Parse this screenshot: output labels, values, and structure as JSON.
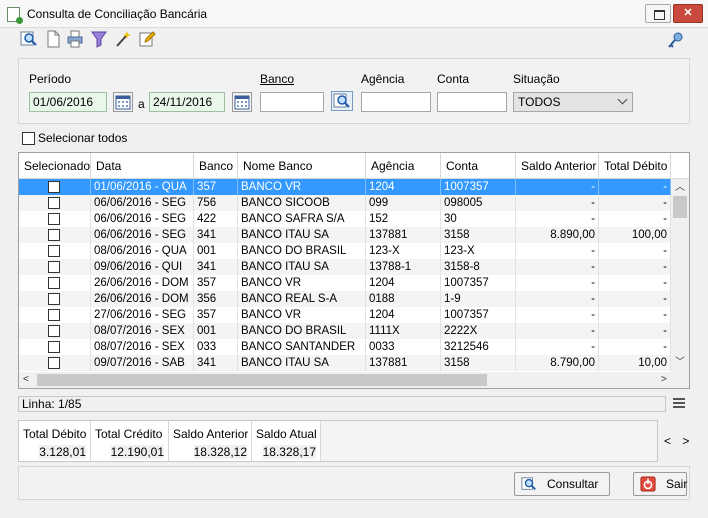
{
  "window": {
    "title": "Consulta de Conciliação Bancária",
    "close_glyph": "✕",
    "icons": [
      "document-green-icon",
      "restore-icon",
      "close-icon"
    ]
  },
  "toolbar": {
    "icons": [
      "zoom-icon",
      "new-document-icon",
      "print-icon",
      "filter-icon",
      "magic-wand-icon",
      "edit-icon",
      "help-key-icon"
    ]
  },
  "filters": {
    "periodo_label": "Período",
    "date_from": "01/06/2016",
    "separator": "a",
    "date_to": "24/11/2016",
    "banco_label": "Banco",
    "banco_value": "",
    "agencia_label": "Agência",
    "agencia_value": "",
    "conta_label": "Conta",
    "conta_value": "",
    "situacao_label": "Situação",
    "situacao_value": "TODOS"
  },
  "select_all_label": "Selecionar todos",
  "grid": {
    "columns": [
      "Selecionado",
      "Data",
      "Banco",
      "Nome Banco",
      "Agência",
      "Conta",
      "Saldo Anterior",
      "Total Débito"
    ],
    "rows": [
      {
        "data": "01/06/2016 - QUA",
        "banco": "357",
        "nome": "BANCO VR",
        "agencia": "1204",
        "conta": "1007357",
        "saldo": "-",
        "debito": "-",
        "selected": true
      },
      {
        "data": "06/06/2016 - SEG",
        "banco": "756",
        "nome": "BANCO SICOOB",
        "agencia": "099",
        "conta": "098005",
        "saldo": "-",
        "debito": "-"
      },
      {
        "data": "06/06/2016 - SEG",
        "banco": "422",
        "nome": "BANCO SAFRA S/A",
        "agencia": "152",
        "conta": "30",
        "saldo": "-",
        "debito": "-"
      },
      {
        "data": "06/06/2016 - SEG",
        "banco": "341",
        "nome": "BANCO ITAU SA",
        "agencia": "137881",
        "conta": "3158",
        "saldo": "8.890,00",
        "debito": "100,00"
      },
      {
        "data": "08/06/2016 - QUA",
        "banco": "001",
        "nome": "BANCO DO BRASIL",
        "agencia": "123-X",
        "conta": "123-X",
        "saldo": "-",
        "debito": "-"
      },
      {
        "data": "09/06/2016 - QUI",
        "banco": "341",
        "nome": "BANCO ITAU SA",
        "agencia": "13788-1",
        "conta": "3158-8",
        "saldo": "-",
        "debito": "-"
      },
      {
        "data": "26/06/2016 - DOM",
        "banco": "357",
        "nome": "BANCO VR",
        "agencia": "1204",
        "conta": "1007357",
        "saldo": "-",
        "debito": "-"
      },
      {
        "data": "26/06/2016 - DOM",
        "banco": "356",
        "nome": "BANCO REAL S-A",
        "agencia": "0188",
        "conta": "1-9",
        "saldo": "-",
        "debito": "-"
      },
      {
        "data": "27/06/2016 - SEG",
        "banco": "357",
        "nome": "BANCO VR",
        "agencia": "1204",
        "conta": "1007357",
        "saldo": "-",
        "debito": "-"
      },
      {
        "data": "08/07/2016 - SEX",
        "banco": "001",
        "nome": "BANCO DO BRASIL",
        "agencia": "1111X",
        "conta": "2222X",
        "saldo": "-",
        "debito": "-"
      },
      {
        "data": "08/07/2016 - SEX",
        "banco": "033",
        "nome": "BANCO SANTANDER",
        "agencia": "0033",
        "conta": "3212546",
        "saldo": "-",
        "debito": "-"
      },
      {
        "data": "09/07/2016 - SAB",
        "banco": "341",
        "nome": "BANCO ITAU SA",
        "agencia": "137881",
        "conta": "3158",
        "saldo": "8.790,00",
        "debito": "10,00"
      }
    ]
  },
  "status": {
    "linha": "Linha: 1/85"
  },
  "totals": [
    {
      "label": "Total Débito",
      "value": "3.128,01"
    },
    {
      "label": "Total Crédito",
      "value": "12.190,01"
    },
    {
      "label": "Saldo Anterior",
      "value": "18.328,12"
    },
    {
      "label": "Saldo Atual",
      "value": "18.328,17"
    }
  ],
  "buttons": {
    "consultar": "Consultar",
    "sair": "Sair"
  }
}
